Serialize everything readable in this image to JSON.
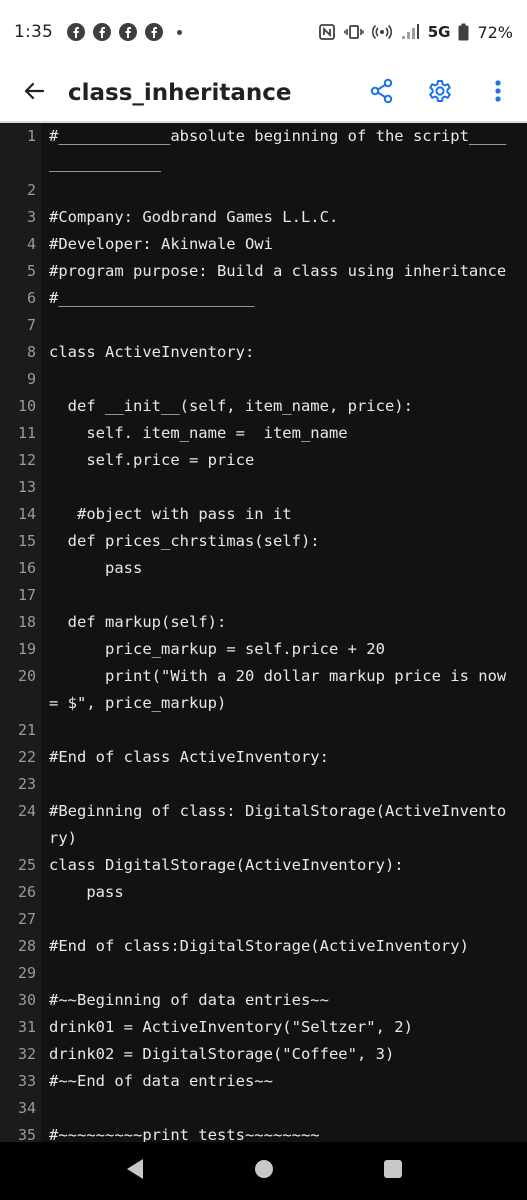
{
  "status_bar": {
    "time": "1:35",
    "network": "5G",
    "battery": "72%",
    "notification_icons": [
      "facebook-icon",
      "facebook-icon",
      "facebook-icon",
      "facebook-icon"
    ]
  },
  "app_bar": {
    "title": "class_inheritance",
    "back_icon": "arrow-back-icon",
    "actions": [
      "share-icon",
      "settings-icon",
      "more-vert-icon"
    ],
    "accent_color": "#1a73e8"
  },
  "editor": {
    "lines": [
      {
        "n": "1",
        "text": "#____________absolute beginning of the script________________"
      },
      {
        "n": "2",
        "text": ""
      },
      {
        "n": "3",
        "text": "#Company: Godbrand Games L.L.C."
      },
      {
        "n": "4",
        "text": "#Developer: Akinwale Owi"
      },
      {
        "n": "5",
        "text": "#program purpose: Build a class using inheritance"
      },
      {
        "n": "6",
        "text": "#_____________________"
      },
      {
        "n": "7",
        "text": ""
      },
      {
        "n": "8",
        "text": "class ActiveInventory:"
      },
      {
        "n": "9",
        "text": ""
      },
      {
        "n": "10",
        "text": "  def __init__(self, item_name, price):"
      },
      {
        "n": "11",
        "text": "    self. item_name =  item_name"
      },
      {
        "n": "12",
        "text": "    self.price = price"
      },
      {
        "n": "13",
        "text": ""
      },
      {
        "n": "14",
        "text": "   #object with pass in it"
      },
      {
        "n": "15",
        "text": "  def prices_chrstimas(self):"
      },
      {
        "n": "16",
        "text": "      pass"
      },
      {
        "n": "17",
        "text": ""
      },
      {
        "n": "18",
        "text": "  def markup(self):"
      },
      {
        "n": "19",
        "text": "      price_markup = self.price + 20"
      },
      {
        "n": "20",
        "text": "      print(\"With a 20 dollar markup price is now = $\", price_markup)"
      },
      {
        "n": "21",
        "text": ""
      },
      {
        "n": "22",
        "text": "#End of class ActiveInventory:"
      },
      {
        "n": "23",
        "text": ""
      },
      {
        "n": "24",
        "text": "#Beginning of class: DigitalStorage(ActiveInventory)"
      },
      {
        "n": "25",
        "text": "class DigitalStorage(ActiveInventory):"
      },
      {
        "n": "26",
        "text": "    pass"
      },
      {
        "n": "27",
        "text": ""
      },
      {
        "n": "28",
        "text": "#End of class:DigitalStorage(ActiveInventory)"
      },
      {
        "n": "29",
        "text": ""
      },
      {
        "n": "30",
        "text": "#~~Beginning of data entries~~"
      },
      {
        "n": "31",
        "text": "drink01 = ActiveInventory(\"Seltzer\", 2)"
      },
      {
        "n": "32",
        "text": "drink02 = DigitalStorage(\"Coffee\", 3)"
      },
      {
        "n": "33",
        "text": "#~~End of data entries~~"
      },
      {
        "n": "34",
        "text": ""
      },
      {
        "n": "35",
        "text": "#~~~~~~~~~print tests~~~~~~~~"
      }
    ]
  },
  "nav_bar": {
    "buttons": [
      "back-triangle-icon",
      "home-circle-icon",
      "recents-square-icon"
    ]
  }
}
